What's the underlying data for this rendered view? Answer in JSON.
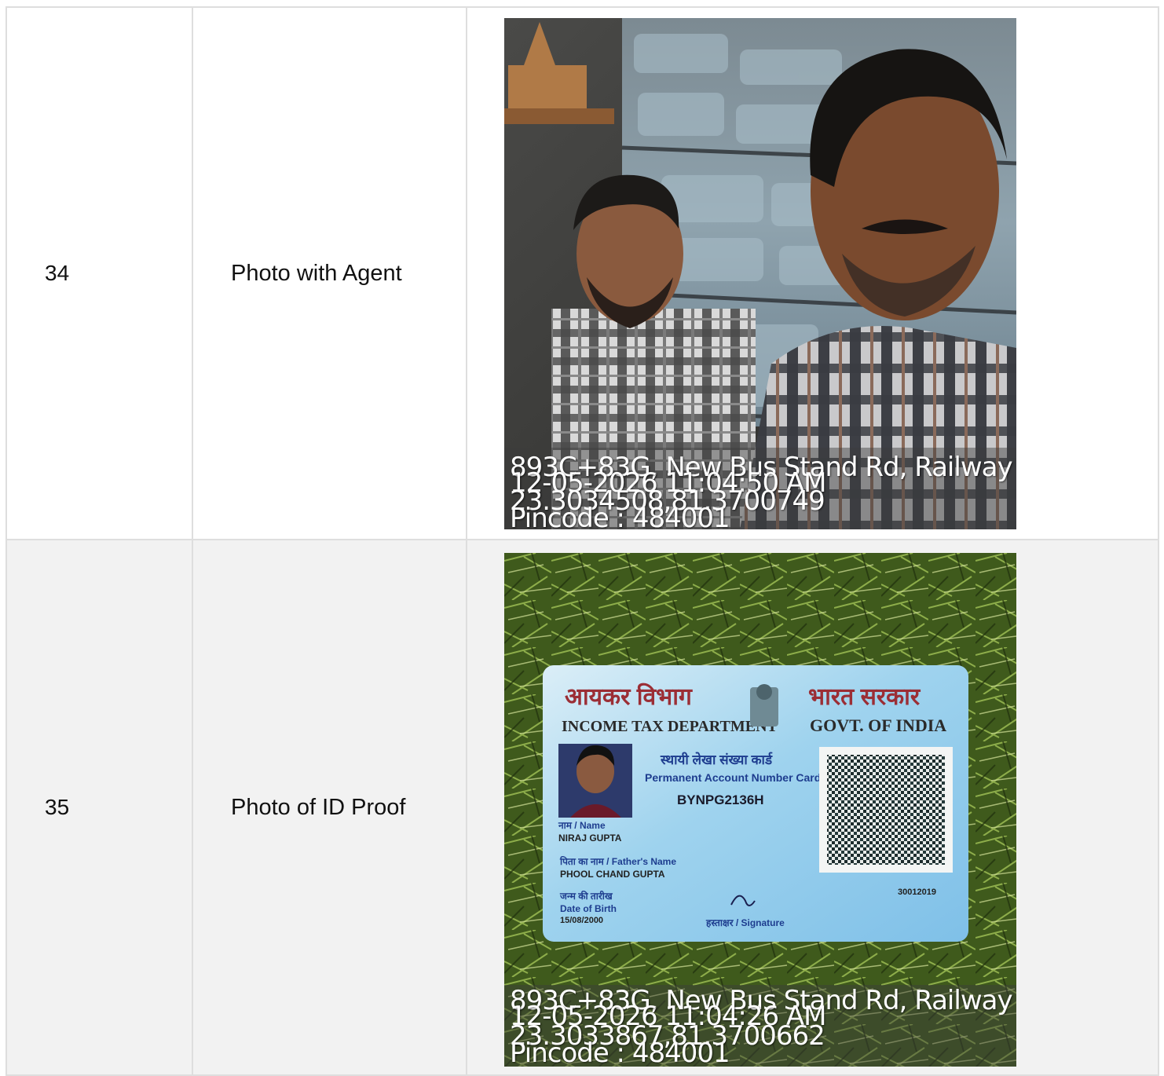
{
  "rows": [
    {
      "number": "34",
      "label": "Photo with Agent",
      "photo_icon": "selfie-photo",
      "overlay": {
        "address": "893C+83G, New Bus Stand Rd, Railway ...",
        "datetime": "12-05-2026 11:04:50 AM",
        "coords": "23.3034508,81.3700749",
        "pincode": "Pincode : 484001"
      }
    },
    {
      "number": "35",
      "label": "Photo of ID Proof",
      "photo_icon": "pan-card-photo",
      "card": {
        "dept_hindi": "आयकर विभाग",
        "dept_english": "INCOME TAX DEPARTMENT",
        "govt_hindi": "भारत सरकार",
        "govt_english": "GOVT. OF INDIA",
        "title_hindi": "स्थायी लेखा संख्या कार्ड",
        "title_english": "Permanent Account Number Card",
        "pan_number": "BYNPG2136H",
        "name_label": "नाम / Name",
        "name": "NIRAJ GUPTA",
        "father_label": "पिता का नाम / Father's Name",
        "father_name": "PHOOL CHAND GUPTA",
        "dob_label_hindi": "जन्म की तारीख",
        "dob_label": "Date of Birth",
        "dob": "15/08/2000",
        "issue_code": "30012019",
        "signature_label": "हस्ताक्षर / Signature"
      },
      "overlay": {
        "address": "893C+83G, New Bus Stand Rd, Railway ...",
        "datetime": "12-05-2026 11:04:26 AM",
        "coords": "23.3033867,81.3700662",
        "pincode": "Pincode : 484001"
      }
    }
  ]
}
